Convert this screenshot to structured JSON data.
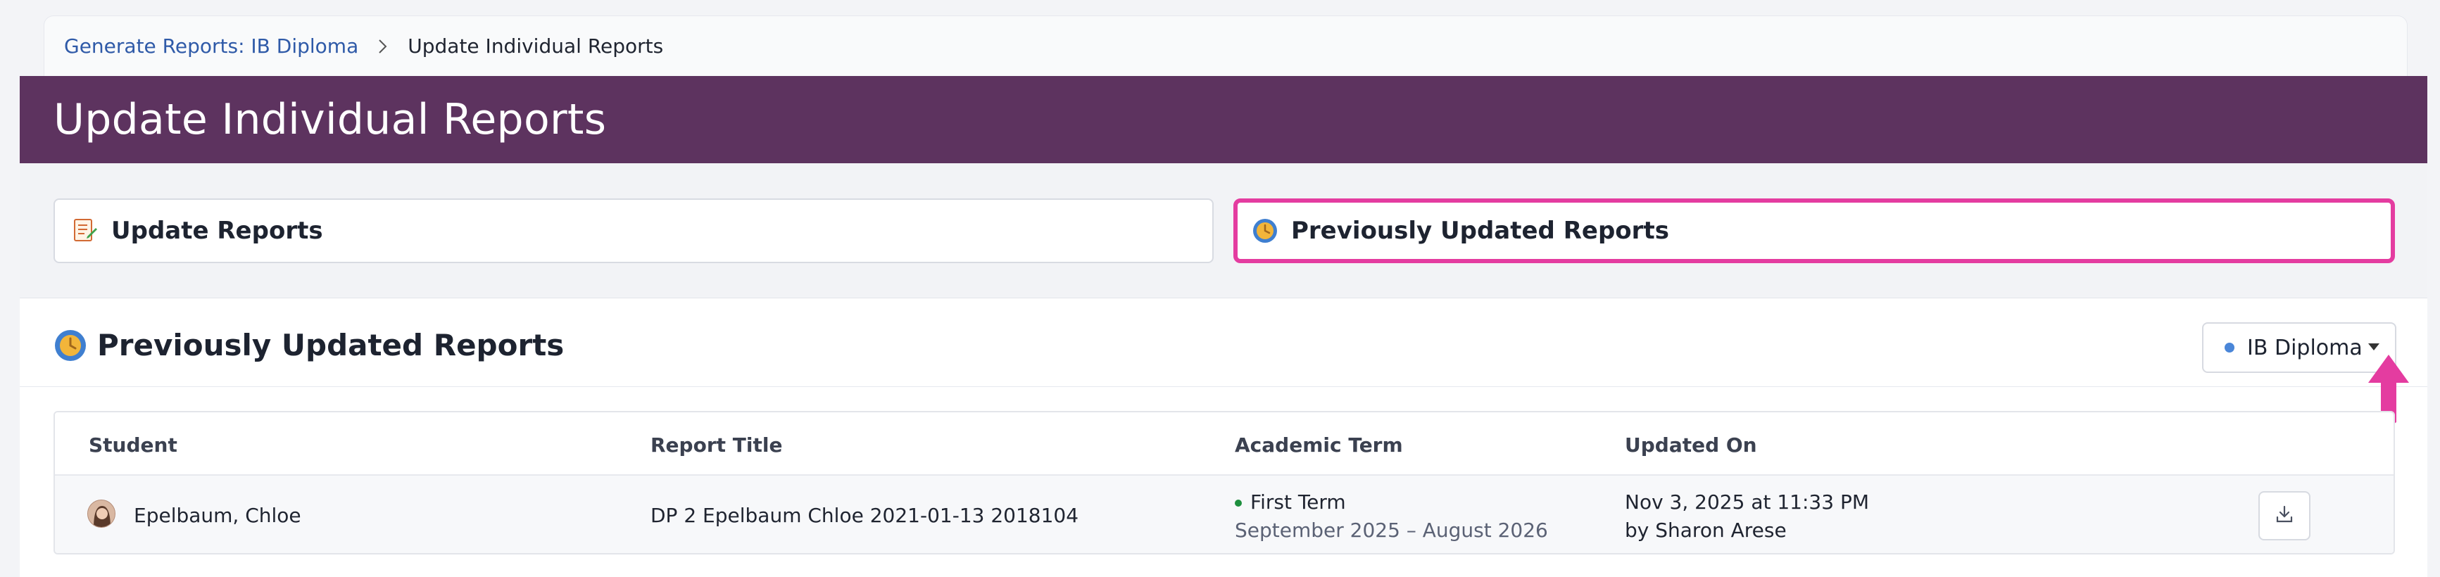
{
  "breadcrumb": {
    "parent": "Generate Reports: IB Diploma",
    "current": "Update Individual Reports"
  },
  "page": {
    "title": "Update Individual Reports"
  },
  "tabs": [
    {
      "label": "Update Reports",
      "icon": "document-edit-icon",
      "selected": false
    },
    {
      "label": "Previously Updated Reports",
      "icon": "clock-icon",
      "selected": true
    }
  ],
  "section": {
    "title": "Previously Updated Reports",
    "icon": "clock-icon",
    "program_filter": {
      "value": "IB Diploma",
      "dot_color": "#4a86d8"
    }
  },
  "table": {
    "columns": [
      "Student",
      "Report Title",
      "Academic Term",
      "Updated On"
    ],
    "rows": [
      {
        "student": "Epelbaum, Chloe",
        "report_title": "DP 2 Epelbaum Chloe 2021-01-13 2018104",
        "term": "First Term",
        "term_range": "September 2025 – August 2026",
        "updated_on": "Nov 3, 2025 at 11:33 PM",
        "updated_by": "by Sharon Arese"
      }
    ]
  },
  "colors": {
    "banner": "#5d335f",
    "highlight": "#e43ca0",
    "link": "#2f5aa8",
    "term_dot": "#1e8f3e"
  }
}
